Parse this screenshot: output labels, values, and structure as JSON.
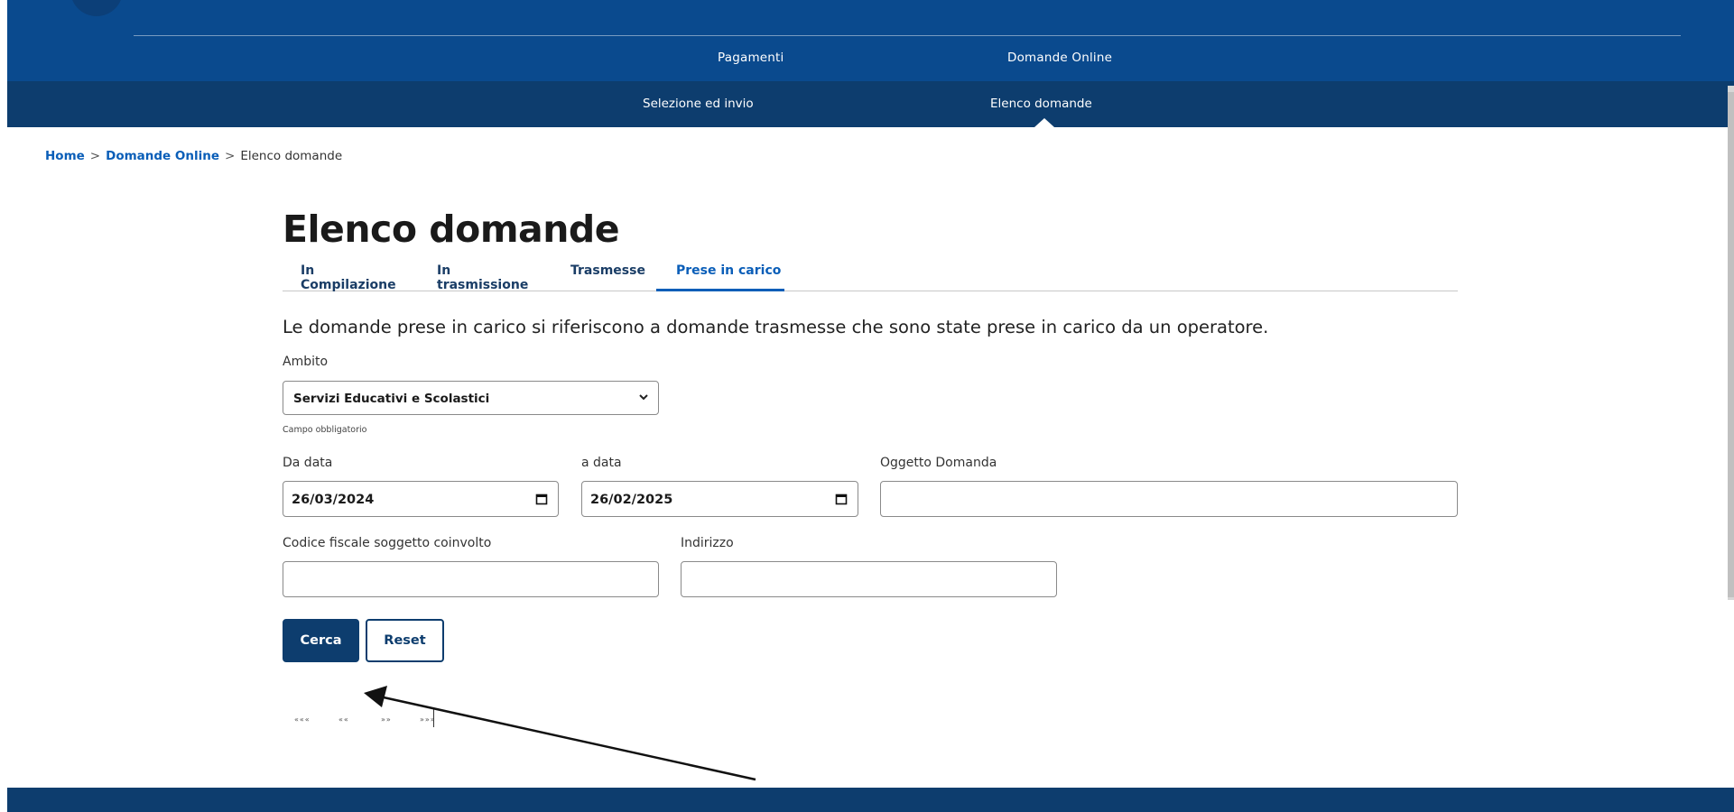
{
  "header": {
    "nav_primary": [
      {
        "label": "Pagamenti"
      },
      {
        "label": "Domande Online"
      }
    ],
    "nav_secondary": [
      {
        "label": "Selezione ed invio"
      },
      {
        "label": "Elenco domande",
        "active": true
      }
    ]
  },
  "breadcrumb": {
    "items": [
      "Home",
      "Domande Online",
      "Elenco domande"
    ],
    "separator": ">"
  },
  "page": {
    "title": "Elenco domande",
    "tabs": [
      {
        "label": "In Compilazione"
      },
      {
        "label": "In trasmissione"
      },
      {
        "label": "Trasmesse"
      },
      {
        "label": "Prese in carico",
        "active": true
      }
    ],
    "intro": "Le domande prese in carico si riferiscono a domande trasmesse che sono state prese in carico da un operatore."
  },
  "form": {
    "ambito": {
      "label": "Ambito",
      "value": "Servizi Educativi e Scolastici",
      "helper": "Campo obbligatorio"
    },
    "da_data": {
      "label": "Da data",
      "value": "26/03/2024"
    },
    "a_data": {
      "label": "a data",
      "value": "26/02/2025"
    },
    "oggetto": {
      "label": "Oggetto Domanda",
      "value": ""
    },
    "codice_fiscale": {
      "label": "Codice fiscale soggetto coinvolto",
      "value": ""
    },
    "indirizzo": {
      "label": "Indirizzo",
      "value": ""
    },
    "buttons": {
      "search": "Cerca",
      "reset": "Reset"
    }
  },
  "pagination": {
    "first": "«««",
    "prev": "««",
    "next": "»»",
    "last": "»»»"
  },
  "colors": {
    "header_primary": "#0a4a8e",
    "header_secondary": "#0d3d6e",
    "link": "#0a5eb8",
    "button_primary": "#0d3d6e"
  },
  "icons": [
    "chevron-down-icon",
    "calendar-icon",
    "arrow-annotation"
  ]
}
